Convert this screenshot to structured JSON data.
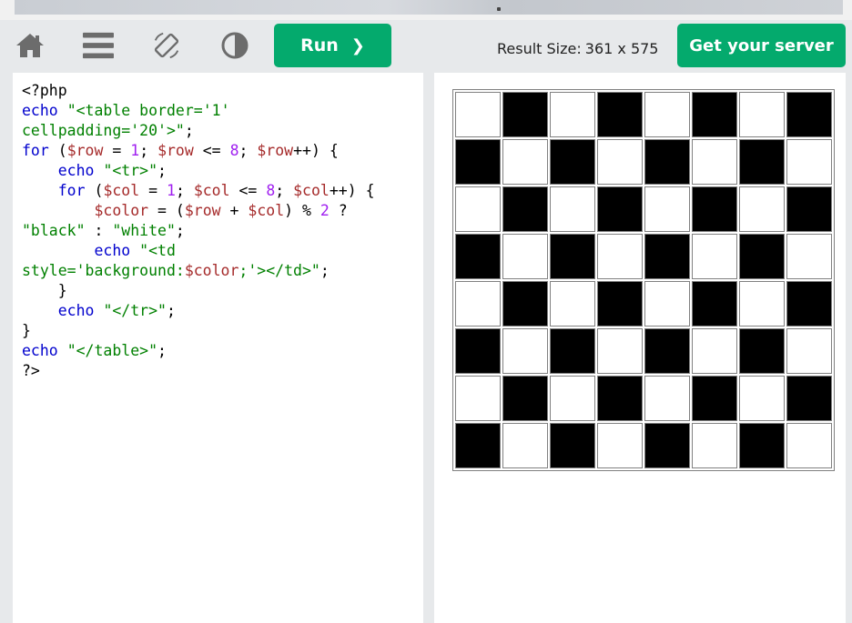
{
  "toolbar": {
    "home_icon": "home-icon",
    "menu_icon": "menu-icon",
    "rotate_icon": "rotate-icon",
    "contrast_icon": "contrast-icon",
    "run_label": "Run",
    "run_chevron": "❯",
    "result_size_label": "Result Size:",
    "result_size_value": "361 x 575",
    "server_label": "Get your server"
  },
  "code_lines": [
    "<?php",
    "echo \"<table border='1'",
    "cellpadding='20'>\";",
    "for ($row = 1; $row <= 8; $row++) {",
    "    echo \"<tr>\";",
    "    for ($col = 1; $col <= 8; $col++) {",
    "        $color = ($row + $col) % 2 ?",
    "\"black\" : \"white\";",
    "        echo \"<td",
    "style='background:$color;'></td>\";",
    "    }",
    "    echo \"</tr>\";",
    "}",
    "echo \"</table>\";",
    "?>"
  ],
  "board": {
    "rows": 8,
    "cols": 8,
    "colors": {
      "black": "#000000",
      "white": "#ffffff"
    }
  },
  "colors": {
    "accent": "#04aa6d",
    "toolbar_bg": "#e7e9eb"
  }
}
